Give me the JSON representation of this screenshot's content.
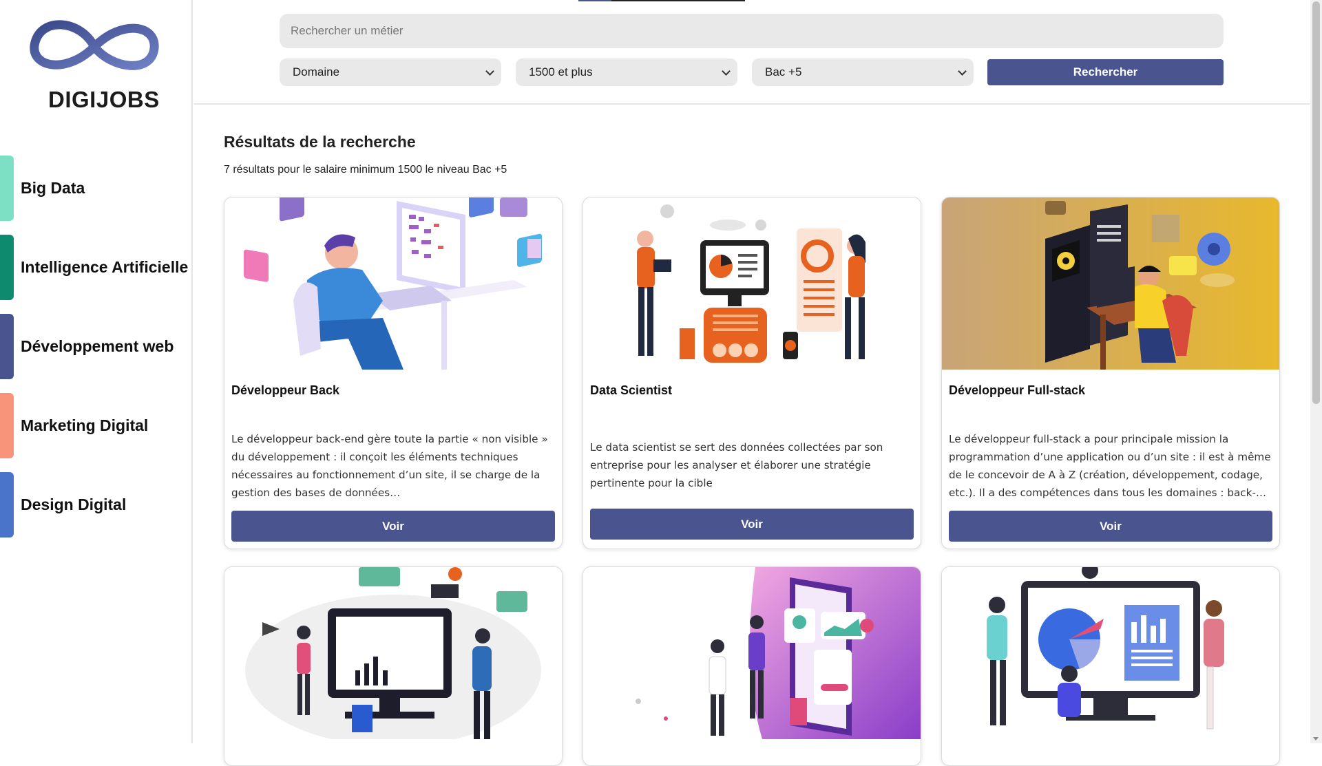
{
  "brand": {
    "name": "DIGIJOBS",
    "logo_icon": "infinity-logo-icon"
  },
  "sidebar": {
    "items": [
      {
        "label": "Big Data",
        "color": "#7de0c4"
      },
      {
        "label": "Intelligence Artificielle",
        "color": "#0e8a6e"
      },
      {
        "label": "Développement web",
        "color": "#4a5590"
      },
      {
        "label": "Marketing Digital",
        "color": "#f89479"
      },
      {
        "label": "Design Digital",
        "color": "#4a74c9"
      }
    ]
  },
  "search": {
    "placeholder": "Rechercher un métier",
    "domain_select": "Domaine",
    "salary_select": "1500 et plus",
    "level_select": "Bac +5",
    "button_label": "Rechercher"
  },
  "results": {
    "title": "Résultats de la recherche",
    "summary": "7 résultats pour le salaire minimum 1500 le niveau Bac +5"
  },
  "cards": [
    {
      "title": "Développeur Back",
      "description": "Le développeur back-end gère toute la partie « non visible » du développement : il conçoit les éléments techniques nécessaires au fonctionnement d’un site, il se charge de la gestion des bases de données…",
      "button_label": "Voir",
      "image": "developer-illustration"
    },
    {
      "title": "Data Scientist",
      "description": "Le data scientist se sert des données collectées par son entreprise pour les analyser et élaborer une stratégie pertinente pour la cible",
      "button_label": "Voir",
      "image": "data-analysis-illustration"
    },
    {
      "title": "Développeur Full-stack",
      "description": "Le développeur full-stack a pour principale mission la programmation d’une application ou d’un site : il est à même de le concevoir de A à Z (création, développement, codage, etc.). Il a des compétences dans tous les domaines : back-…",
      "button_label": "Voir",
      "image": "fullstack-illustration"
    },
    {
      "image": "marketing-illustration"
    },
    {
      "image": "mobile-design-illustration"
    },
    {
      "image": "presentation-illustration"
    }
  ],
  "colors": {
    "accent": "#4a5590",
    "field_bg": "#e9e9e9",
    "fullstack_bg": "#d9a93c"
  }
}
